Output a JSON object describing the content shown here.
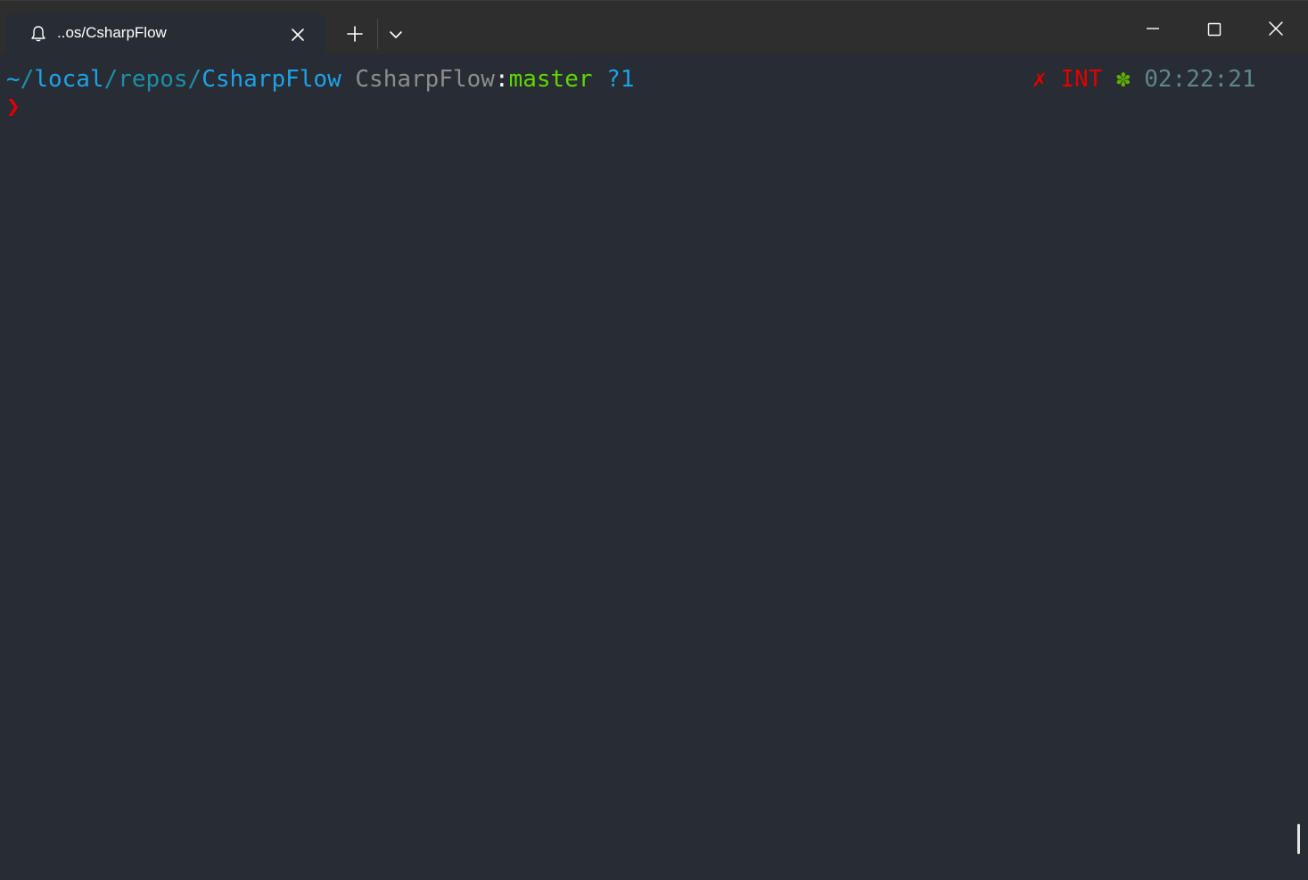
{
  "tab": {
    "title": "..os/CsharpFlow",
    "icon": "bell-icon"
  },
  "titlebar": {
    "new_tab_icon": "plus-icon",
    "dropdown_icon": "chevron-down-icon",
    "minimize_icon": "minimize-icon",
    "maximize_icon": "maximize-icon",
    "close_icon": "close-icon"
  },
  "prompt": {
    "path": {
      "tilde": "~",
      "sep1": "/",
      "dir1": "local",
      "sep2": "/",
      "dir2": "repos",
      "sep3": "/",
      "dir3": "CsharpFlow"
    },
    "repo_name": "CsharpFlow",
    "colon": ":",
    "branch": "master",
    "git_status": "?1",
    "status_symbol": "✗",
    "status_text": "INT",
    "gear_symbol": "✽",
    "time": "02:22:21",
    "prompt_char": "❯"
  },
  "colors": {
    "background": "#282c34",
    "titlebar": "#2e2e2e",
    "path_bright": "#1ea2e6",
    "path_dim": "#1c8fa8",
    "repo_gray": "#8c8c8c",
    "branch_green": "#5fd700",
    "error_red": "#e00000",
    "gear_green": "#5faf00",
    "time_teal": "#5f8787"
  }
}
